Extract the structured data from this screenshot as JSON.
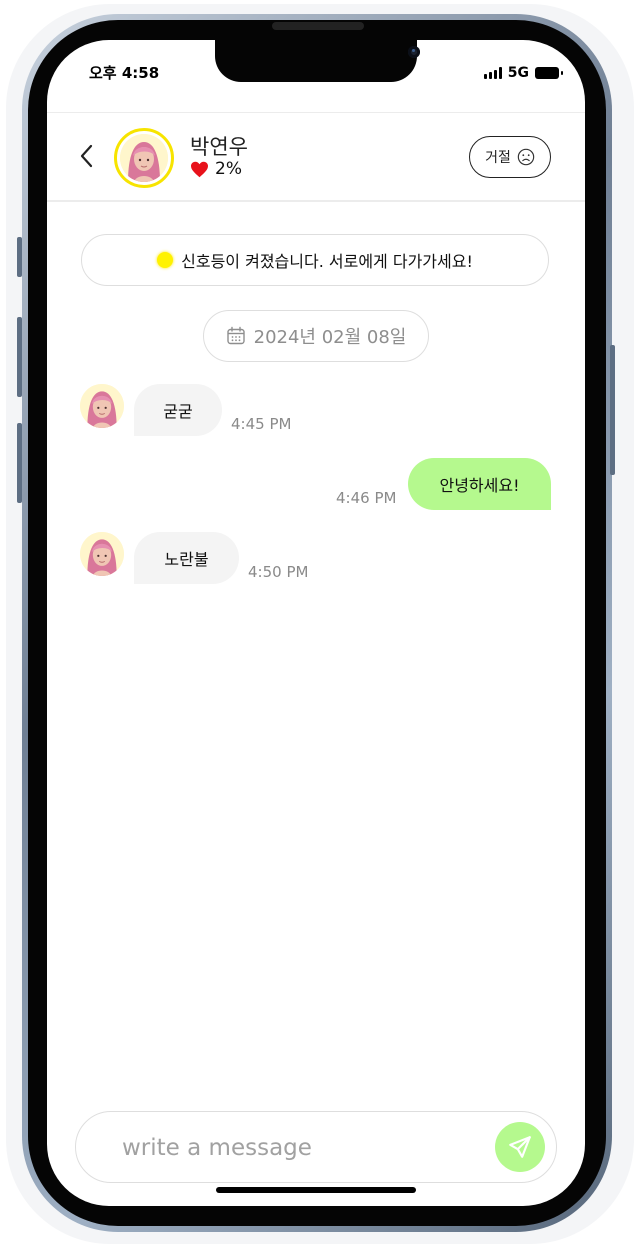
{
  "status_bar": {
    "time": "오후 4:58",
    "network": "5G"
  },
  "header": {
    "name": "박연우",
    "affinity": "2%",
    "reject_label": "거절"
  },
  "notice": {
    "text": "신호등이 켜졌습니다. 서로에게 다가가세요!"
  },
  "date_divider": {
    "text": "2024년 02월 08일"
  },
  "messages": [
    {
      "direction": "in",
      "text": "굳굳",
      "time": "4:45 PM"
    },
    {
      "direction": "out",
      "text": "안녕하세요!",
      "time": "4:46 PM"
    },
    {
      "direction": "in",
      "text": "노란불",
      "time": "4:50 PM"
    }
  ],
  "composer": {
    "placeholder": "write a message"
  },
  "colors": {
    "accent_green": "#b5f98e",
    "signal_yellow": "#fff200",
    "avatar_ring": "#f7e400",
    "heart": "#e8121b"
  },
  "icons": {
    "back": "chevron-left-icon",
    "reject": "sad-face-icon",
    "date": "calendar-icon",
    "send": "send-icon",
    "affinity": "heart-icon"
  }
}
